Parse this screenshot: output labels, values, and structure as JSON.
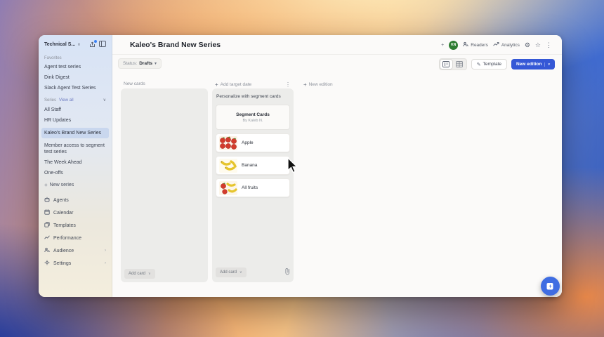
{
  "colors": {
    "accent_blue": "#3558d6",
    "avatar_green": "#2f7d33",
    "selected_bg": "#c9d7ee"
  },
  "window": {
    "titlebar": {
      "workspace_label": "Technical S...",
      "chevron": "∨"
    },
    "sidebar": {
      "favorites_label": "Favorites",
      "favorites": [
        {
          "label": "Agent test series"
        },
        {
          "label": "Dink Digest"
        },
        {
          "label": "Slack Agent Test Series"
        }
      ],
      "series_label": "Series",
      "view_all_label": "View all",
      "series": [
        {
          "label": "All Staff"
        },
        {
          "label": "HR Updates"
        },
        {
          "label": "Kaleo's Brand New Series"
        },
        {
          "label": "Member access to segment test series"
        },
        {
          "label": "The Week Ahead"
        },
        {
          "label": "One-offs"
        }
      ],
      "selected_series": "Kaleo's Brand New Series",
      "new_series_label": "New series",
      "nav": [
        {
          "label": "Agents"
        },
        {
          "label": "Calendar"
        },
        {
          "label": "Templates"
        },
        {
          "label": "Performance"
        },
        {
          "label": "Audience"
        },
        {
          "label": "Settings"
        }
      ]
    },
    "header": {
      "title": "Kaleo's Brand New Series",
      "add_label": "+",
      "avatar_initials": "KN",
      "readers_label": "Readers",
      "analytics_label": "Analytics",
      "gear_glyph": "⚙",
      "star_glyph": "☆",
      "more_glyph": "⋮"
    },
    "toolbar": {
      "status_label": "Status:",
      "status_value": "Drafts",
      "template_label": "Template",
      "new_edition_label": "New edition",
      "pencil_glyph": "✎"
    },
    "board": {
      "col1": {
        "header": "New cards",
        "add_card_label": "Add card"
      },
      "col2": {
        "header": "Add target date",
        "more_glyph": "⋮",
        "hint": "Personalize with segment cards",
        "deck_title": "Segment Cards",
        "deck_byline": "By Kaleb N.",
        "cards": [
          {
            "label": "Apple"
          },
          {
            "label": "Banana"
          },
          {
            "label": "All fruits"
          }
        ],
        "add_card_label": "Add card"
      },
      "col3": {
        "header": "New edition"
      }
    }
  }
}
